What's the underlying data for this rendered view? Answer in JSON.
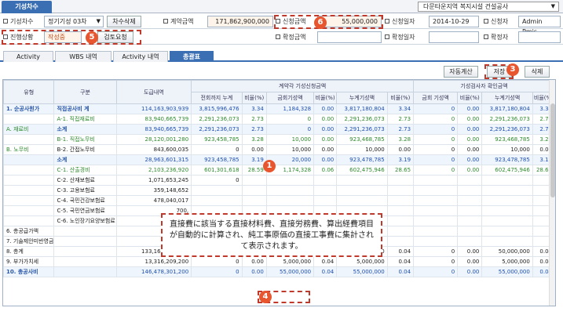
{
  "top": {
    "main_tab": "기성차수",
    "project_select": "다문타운지역 복지시설 건설공사"
  },
  "form": {
    "row1": {
      "label_round": "기성차수",
      "round_value": "정기기성 03차",
      "delete_round_btn": "차수삭제",
      "label_contract": "계약금액",
      "contract_value": "171,862,900,000",
      "label_request_amt": "신청금액",
      "request_amt_value": "55,000,000",
      "label_request_date": "신청일자",
      "request_date_value": "2014-10-29",
      "label_applicant": "신청자",
      "applicant_value": "Admin Pmis"
    },
    "row2": {
      "label_status": "진행상황",
      "status_value": "작성중",
      "review_btn": "검토요청",
      "label_confirm_amt": "확정금액",
      "label_confirm_date": "확정일자",
      "label_confirmer": "확정자"
    }
  },
  "tabs": [
    "Activity",
    "WBS 내역",
    "Activity 내역",
    "총괄표"
  ],
  "toolbar": {
    "autocalc_btn": "자동계산",
    "save_btn": "저장",
    "delete_btn": "삭제"
  },
  "grid": {
    "header_group_req": "계약각 기성신청금액",
    "header_group_conf": "기성검사자 확인금액",
    "headers_top": [
      "유형",
      "구분",
      "도급내역"
    ],
    "headers_sub": [
      "전회까지 누계",
      "비율(%)",
      "금회기성액",
      "비율(%)",
      "누계기성액",
      "비율(%)",
      "금회 기성액",
      "비율(%)",
      "누계기성액",
      "비율(%)"
    ],
    "rows": [
      {
        "type": "1. 순공사원가",
        "div": "직접공사비 계",
        "contract": "114,163,903,939",
        "c1": "3,815,996,476",
        "c2": "3.34",
        "c3": "1,184,328",
        "c4": "0.00",
        "c5": "3,817,180,804",
        "c6": "3.34",
        "c7": "0",
        "c8": "0.00",
        "c9": "3,817,180,804",
        "c10": "3.34",
        "style": "total",
        "typeStyle": "grp",
        "divStyle": "grp"
      },
      {
        "type": "",
        "div": "A-1. 직접재료비",
        "contract": "83,940,665,739",
        "c1": "2,291,236,073",
        "c2": "2.73",
        "c3": "0",
        "c4": "0.00",
        "c5": "2,291,236,073",
        "c6": "2.73",
        "c7": "0",
        "c8": "0.00",
        "c9": "2,291,236,073",
        "c10": "2.73",
        "style": "",
        "typeStyle": "",
        "divStyle": "subgrp"
      },
      {
        "type": "A. 재료비",
        "div": "소계",
        "contract": "83,940,665,739",
        "c1": "2,291,236,073",
        "c2": "2.73",
        "c3": "0",
        "c4": "0.00",
        "c5": "2,291,236,073",
        "c6": "2.73",
        "c7": "0",
        "c8": "0.00",
        "c9": "2,291,236,073",
        "c10": "2.73",
        "style": "sub",
        "typeStyle": "subgrp",
        "divStyle": "grp"
      },
      {
        "type": "",
        "div": "B-1. 직접노무비",
        "contract": "28,120,001,280",
        "c1": "923,458,785",
        "c2": "3.28",
        "c3": "10,000",
        "c4": "0.00",
        "c5": "923,468,785",
        "c6": "3.28",
        "c7": "0",
        "c8": "0.00",
        "c9": "923,468,785",
        "c10": "3.28",
        "style": "",
        "typeStyle": "",
        "divStyle": "subgrp"
      },
      {
        "type": "B. 노무비",
        "div": "B-2. 간접노무비",
        "contract": "843,600,035",
        "c1": "0",
        "c2": "0.00",
        "c3": "10,000",
        "c4": "0.00",
        "c5": "10,000",
        "c6": "0.00",
        "c7": "0",
        "c8": "0.00",
        "c9": "10,000",
        "c10": "0.00",
        "style": "",
        "typeStyle": "subgrp",
        "divStyle": "item"
      },
      {
        "type": "",
        "div": "소계",
        "contract": "28,963,601,315",
        "c1": "923,458,785",
        "c2": "3.19",
        "c3": "20,000",
        "c4": "0.00",
        "c5": "923,478,785",
        "c6": "3.19",
        "c7": "0",
        "c8": "0.00",
        "c9": "923,478,785",
        "c10": "3.19",
        "style": "sub",
        "typeStyle": "",
        "divStyle": "grp"
      },
      {
        "type": "",
        "div": "C-1. 산출경비",
        "contract": "2,103,236,920",
        "c1": "601,301,618",
        "c2": "28.59",
        "c3": "1,174,328",
        "c4": "0.06",
        "c5": "602,475,946",
        "c6": "28.65",
        "c7": "0",
        "c8": "0.00",
        "c9": "602,475,946",
        "c10": "28.65",
        "style": "",
        "typeStyle": "",
        "divStyle": "subgrp"
      },
      {
        "type": "",
        "div": "C-2. 산재보험료",
        "contract": "1,071,653,245",
        "c1": "0",
        "c2": "",
        "c3": "",
        "c4": "",
        "c5": "",
        "c6": "",
        "c7": "",
        "c8": "",
        "c9": "",
        "c10": "",
        "style": "",
        "typeStyle": "",
        "divStyle": "item"
      },
      {
        "type": "",
        "div": "C-3. 고용보험료",
        "contract": "359,148,652",
        "c1": "",
        "c2": "",
        "c3": "",
        "c4": "",
        "c5": "",
        "c6": "",
        "c7": "",
        "c8": "",
        "c9": "",
        "c10": "",
        "style": "",
        "typeStyle": "",
        "divStyle": "item"
      },
      {
        "type": "",
        "div": "C-4. 국민건강보험료",
        "contract": "478,040,017",
        "c1": "",
        "c2": "",
        "c3": "",
        "c4": "",
        "c5": "",
        "c6": "",
        "c7": "",
        "c8": "",
        "c9": "",
        "c10": "",
        "style": "",
        "typeStyle": "",
        "divStyle": "item"
      },
      {
        "type": "",
        "div": "C-5. 국민연금보험료",
        "contract": "700,",
        "c1": "",
        "c2": "",
        "c3": "",
        "c4": "",
        "c5": "",
        "c6": "",
        "c7": "",
        "c8": "",
        "c9": "",
        "c10": "",
        "style": "",
        "typeStyle": "",
        "divStyle": "item"
      },
      {
        "type": "",
        "div": "C-6. 노인장기요양보험료",
        "contract": "33,",
        "c1": "",
        "c2": "",
        "c3": "",
        "c4": "",
        "c5": "",
        "c6": "",
        "c7": "",
        "c8": "",
        "c9": "",
        "c10": "",
        "style": "",
        "typeStyle": "",
        "divStyle": "item"
      },
      {
        "type": "6. 총공급가액",
        "div": "",
        "contract": "132,824,0",
        "c1": "",
        "c2": "",
        "c3": "",
        "c4": "",
        "c5": "",
        "c6": "",
        "c7": "",
        "c8": "",
        "c9": "",
        "c10": "",
        "style": "",
        "typeStyle": "",
        "divStyle": ""
      },
      {
        "type": "7. 기술제안미반영금",
        "div": "",
        "contract": "338,0",
        "c1": "",
        "c2": "",
        "c3": "",
        "c4": "",
        "c5": "",
        "c6": "",
        "c7": "",
        "c8": "",
        "c9": "",
        "c10": "",
        "style": "",
        "typeStyle": "",
        "divStyle": ""
      },
      {
        "type": "8. 총계",
        "div": "",
        "contract": "133,162,092,000",
        "c1": "0",
        "c2": "0.00",
        "c3": "50,000,000",
        "c4": "0.04",
        "c5": "50,000,000",
        "c6": "0.04",
        "c7": "0",
        "c8": "0.00",
        "c9": "50,000,000",
        "c10": "0.04",
        "style": "",
        "typeStyle": "",
        "divStyle": ""
      },
      {
        "type": "9. 부가가치세",
        "div": "",
        "contract": "13,316,209,200",
        "c1": "0",
        "c2": "0.00",
        "c3": "5,000,000",
        "c4": "0.04",
        "c5": "5,000,000",
        "c6": "0.04",
        "c7": "0",
        "c8": "0.00",
        "c9": "5,000,000",
        "c10": "0.04",
        "style": "",
        "typeStyle": "",
        "divStyle": ""
      },
      {
        "type": "10. 총공사비",
        "div": "",
        "contract": "146,478,301,200",
        "c1": "0",
        "c2": "0.00",
        "c3": "55,000,000",
        "c4": "0.04",
        "c5": "55,000,000",
        "c6": "0.04",
        "c7": "0",
        "c8": "0.00",
        "c9": "55,000,000",
        "c10": "0.04",
        "style": "total",
        "typeStyle": "grp",
        "divStyle": ""
      }
    ]
  },
  "note": {
    "text": "直接費に該当する直接材料費、直接労務費、算出経費項目が自動的に計算され、純工事原価の直接工事費に集計されて表示されます。"
  },
  "badges": [
    "1",
    "3",
    "4",
    "5",
    "6"
  ],
  "colors": {
    "accent": "#3b6fb3",
    "badge": "#e8562f",
    "highlight": "#c0392b"
  }
}
